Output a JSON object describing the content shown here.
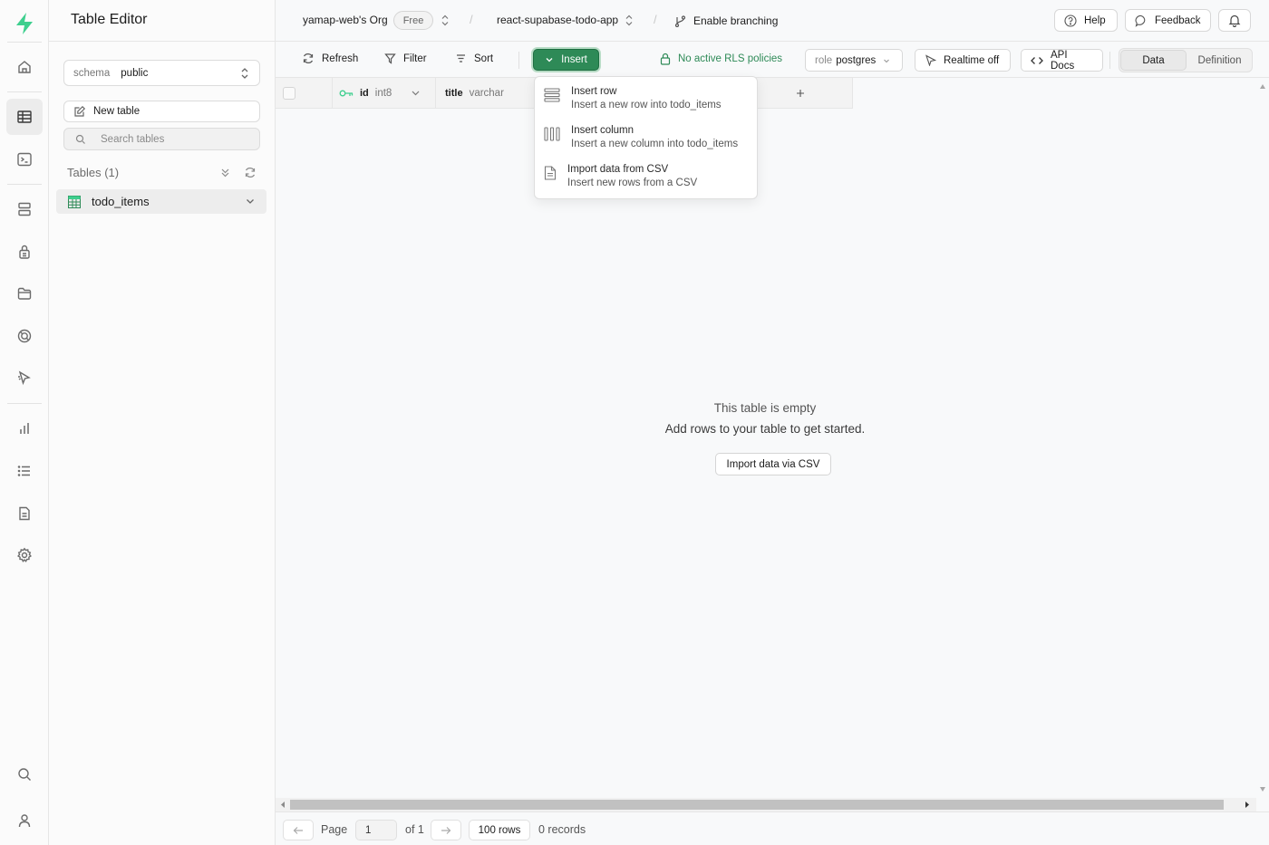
{
  "app": {
    "title": "Table Editor"
  },
  "colors": {
    "brand": "#3ecf8e",
    "accent": "#2e8a57"
  },
  "rail": {
    "items": [
      {
        "name": "home-icon"
      },
      {
        "name": "table-editor-icon"
      },
      {
        "name": "sql-editor-icon"
      },
      {
        "name": "database-icon"
      },
      {
        "name": "auth-icon"
      },
      {
        "name": "storage-icon"
      },
      {
        "name": "edge-functions-icon"
      },
      {
        "name": "realtime-icon"
      },
      {
        "name": "reports-icon"
      },
      {
        "name": "logs-icon"
      },
      {
        "name": "api-docs-icon"
      },
      {
        "name": "settings-icon"
      },
      {
        "name": "search-icon"
      },
      {
        "name": "user-icon"
      }
    ]
  },
  "sidebar": {
    "schema_label": "schema",
    "schema_value": "public",
    "new_table": "New table",
    "search_placeholder": "Search tables",
    "tables_heading": "Tables (1)",
    "tables": [
      {
        "name": "todo_items"
      }
    ]
  },
  "topbar": {
    "org": "yamap-web's Org",
    "plan": "Free",
    "project": "react-supabase-todo-app",
    "branching": "Enable branching",
    "help": "Help",
    "feedback": "Feedback"
  },
  "toolbar": {
    "refresh": "Refresh",
    "filter": "Filter",
    "sort": "Sort",
    "insert": "Insert",
    "rls": "No active RLS policies",
    "role_label": "role",
    "role_value": "postgres",
    "realtime": "Realtime off",
    "api_docs": "API Docs",
    "tab_data": "Data",
    "tab_definition": "Definition"
  },
  "columns": [
    {
      "name": "id",
      "type": "int8"
    },
    {
      "name": "title",
      "type": "varchar"
    }
  ],
  "insert_menu": [
    {
      "title": "Insert row",
      "desc": "Insert a new row into todo_items"
    },
    {
      "title": "Insert column",
      "desc": "Insert a new column into todo_items"
    },
    {
      "title": "Import data from CSV",
      "desc": "Insert new rows from a CSV"
    }
  ],
  "empty_state": {
    "title": "This table is empty",
    "subtitle": "Add rows to your table to get started.",
    "button": "Import data via CSV"
  },
  "footer": {
    "page_label": "Page",
    "page_value": "1",
    "of_pages": "of 1",
    "rows_per_page": "100 rows",
    "records": "0 records"
  }
}
